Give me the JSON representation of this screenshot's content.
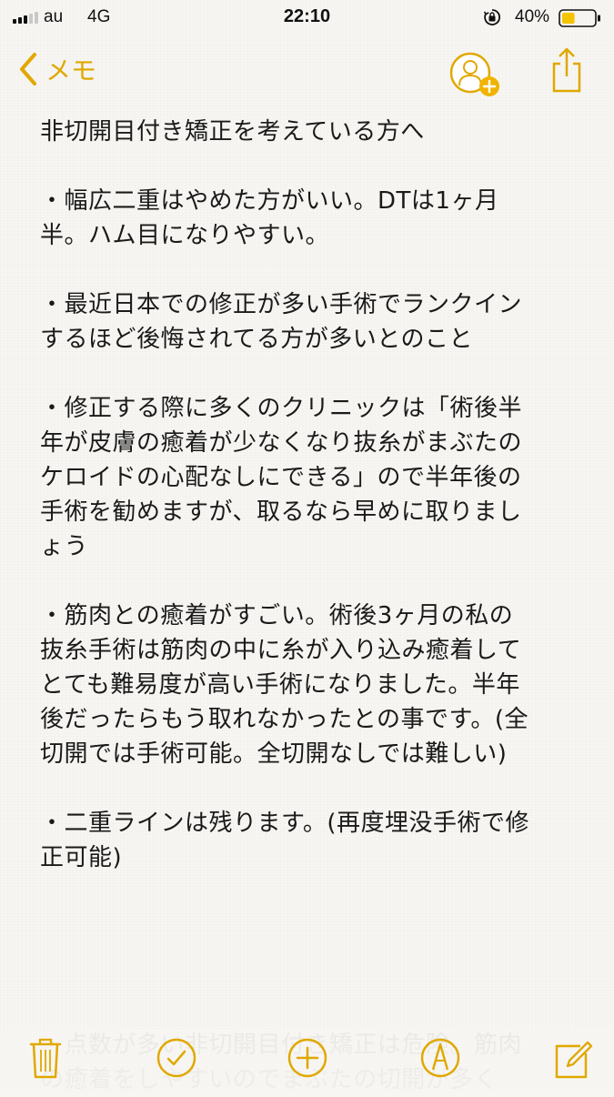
{
  "status_bar": {
    "carrier": "au",
    "network": "4G",
    "time": "22:10",
    "battery_percent": "40%",
    "signal_bars_on": 3,
    "signal_bars_total": 5,
    "battery_level": 0.4,
    "battery_color": "#f5c400"
  },
  "nav": {
    "back_label": "メモ",
    "accent_color": "#e0a800",
    "icons": [
      "chevron-left-icon",
      "add-person-icon",
      "share-icon"
    ]
  },
  "note": {
    "lines": [
      "非切開目付き矯正を考えている方へ",
      "",
      "・幅広二重はやめた方がいい。DTは1ヶ月",
      "半。ハム目になりやすい。",
      "",
      "・最近日本での修正が多い手術でランクイン",
      "するほど後悔されてる方が多いとのこと",
      "",
      "・修正する際に多くのクリニックは「術後半",
      "年が皮膚の癒着が少なくなり抜糸がまぶたの",
      "ケロイドの心配なしにできる」ので半年後の",
      "手術を勧めますが、取るなら早めに取りまし",
      "ょう",
      "",
      "・筋肉との癒着がすごい。術後3ヶ月の私の",
      "抜糸手術は筋肉の中に糸が入り込み癒着して",
      "とても難易度が高い手術になりました。半年",
      "後だったらもう取れなかったとの事です。(全",
      "切開では手術可能。全切開なしでは難しい)",
      "",
      "・二重ラインは残ります。(再度埋没手術で修",
      "正可能)"
    ],
    "overflow_lines": [
      "・点数が多い非切開目付き矯正は危険。筋肉",
      "の癒着をしやすいのでまぶたの切開が多く"
    ]
  },
  "toolbar": {
    "icons": [
      "trash-icon",
      "checklist-icon",
      "add-icon",
      "sketch-icon",
      "compose-icon"
    ]
  }
}
